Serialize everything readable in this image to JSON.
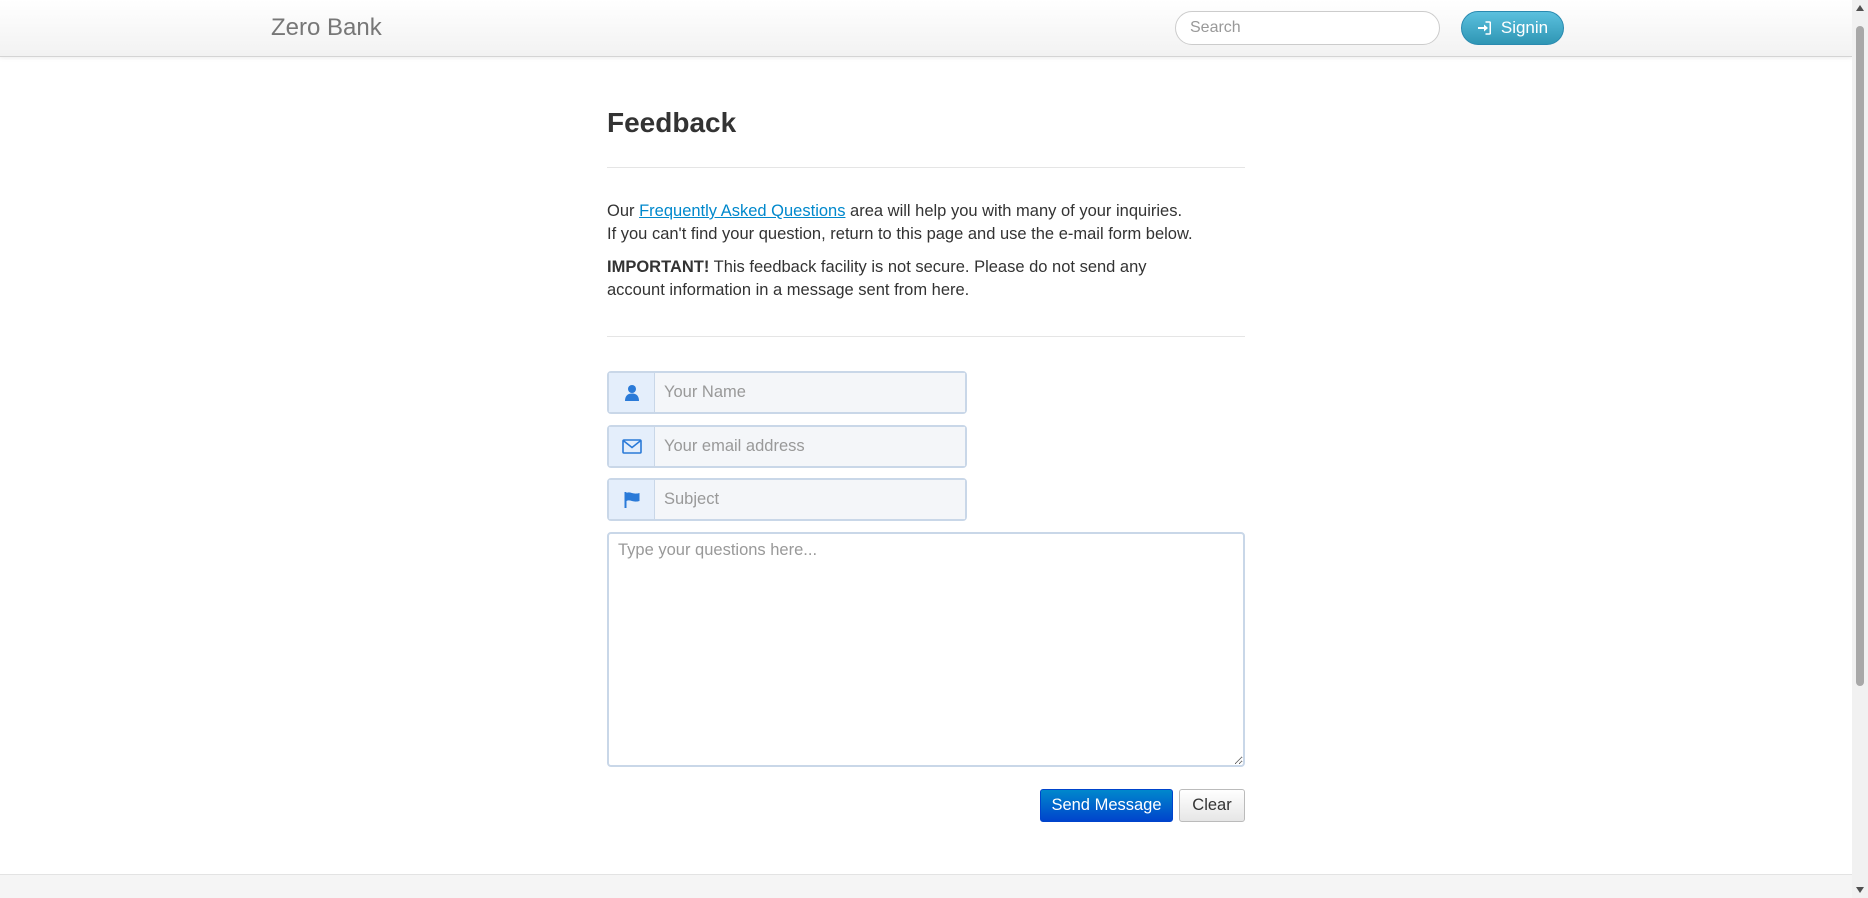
{
  "navbar": {
    "brand": "Zero Bank",
    "search_placeholder": "Search",
    "signin_label": "Signin",
    "signin_icon": "signin-icon"
  },
  "main": {
    "title": "Feedback",
    "intro_prefix": "Our ",
    "faq_link": "Frequently Asked Questions",
    "intro_suffix": " area will help you with many of your inquiries.",
    "intro_line2": "If you can't find your question, return to this page and use the e-mail form below.",
    "important_label": "IMPORTANT!",
    "important_line1": " This feedback facility is not secure. Please do not send any",
    "important_line2": "account information in a message sent from here."
  },
  "form": {
    "name": {
      "placeholder": "Your Name",
      "icon": "user-icon"
    },
    "email": {
      "placeholder": "Your email address",
      "icon": "envelope-icon"
    },
    "subject": {
      "placeholder": "Subject",
      "icon": "flag-icon"
    },
    "message": {
      "placeholder": "Type your questions here..."
    },
    "send_label": "Send Message",
    "clear_label": "Clear"
  },
  "colors": {
    "accent": "#0088cc",
    "signin": "#2f96b4",
    "icon": "#2a7ad8"
  }
}
